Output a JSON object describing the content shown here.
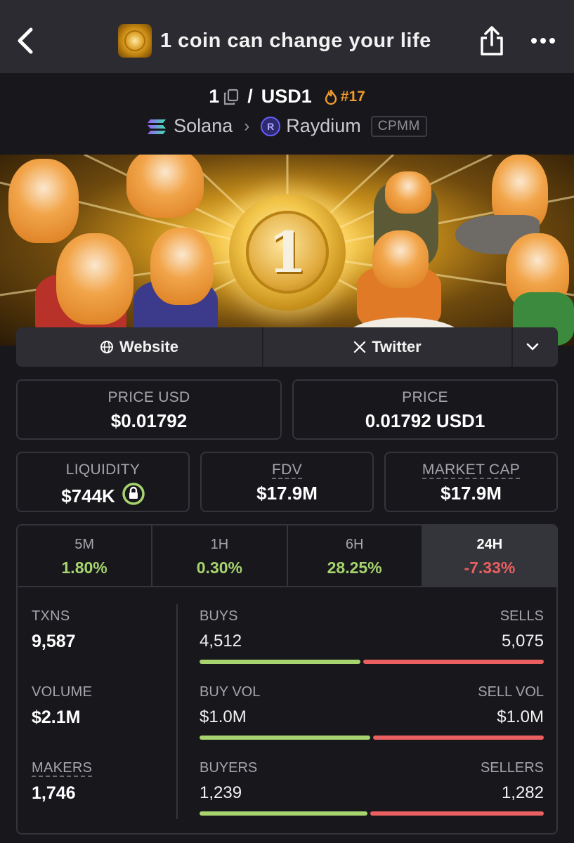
{
  "header": {
    "title": "1 coin can change your life",
    "back_icon": "back-chevron-icon",
    "share_icon": "share-icon",
    "more_icon": "more-dots-icon"
  },
  "pair": {
    "base": "1",
    "quote": "USD1",
    "separator": "/",
    "rank": "#17",
    "chain": "Solana",
    "dex": "Raydium",
    "pool_type": "CPMM"
  },
  "links": {
    "website": "Website",
    "twitter": "Twitter"
  },
  "stats": {
    "price_usd_label": "PRICE USD",
    "price_usd": "$0.01792",
    "price_label": "PRICE",
    "price": "0.01792 USD1",
    "liquidity_label": "LIQUIDITY",
    "liquidity": "$744K",
    "fdv_label": "FDV",
    "fdv": "$17.9M",
    "mcap_label": "MARKET CAP",
    "mcap": "$17.9M"
  },
  "timeframes": [
    {
      "label": "5M",
      "value": "1.80%",
      "direction": "up"
    },
    {
      "label": "1H",
      "value": "0.30%",
      "direction": "up"
    },
    {
      "label": "6H",
      "value": "28.25%",
      "direction": "up"
    },
    {
      "label": "24H",
      "value": "-7.33%",
      "direction": "down",
      "active": true
    }
  ],
  "metrics": {
    "txns_label": "TXNS",
    "txns": "9,587",
    "volume_label": "VOLUME",
    "volume": "$2.1M",
    "makers_label": "MAKERS",
    "makers": "1,746",
    "buys_label": "BUYS",
    "buys": "4,512",
    "sells_label": "SELLS",
    "sells": "5,075",
    "buy_vol_label": "BUY VOL",
    "buy_vol": "$1.0M",
    "sell_vol_label": "SELL VOL",
    "sell_vol": "$1.0M",
    "buyers_label": "BUYERS",
    "buyers": "1,239",
    "sellers_label": "SELLERS",
    "sellers": "1,282",
    "buys_fraction": 0.4706,
    "buy_vol_fraction": 0.5,
    "buyers_fraction": 0.4915
  },
  "colors": {
    "background": "#17171c",
    "topbar": "#2b2b31",
    "positive": "#a7d46e",
    "negative": "#ea5f5f",
    "rank": "#f09a2e"
  }
}
